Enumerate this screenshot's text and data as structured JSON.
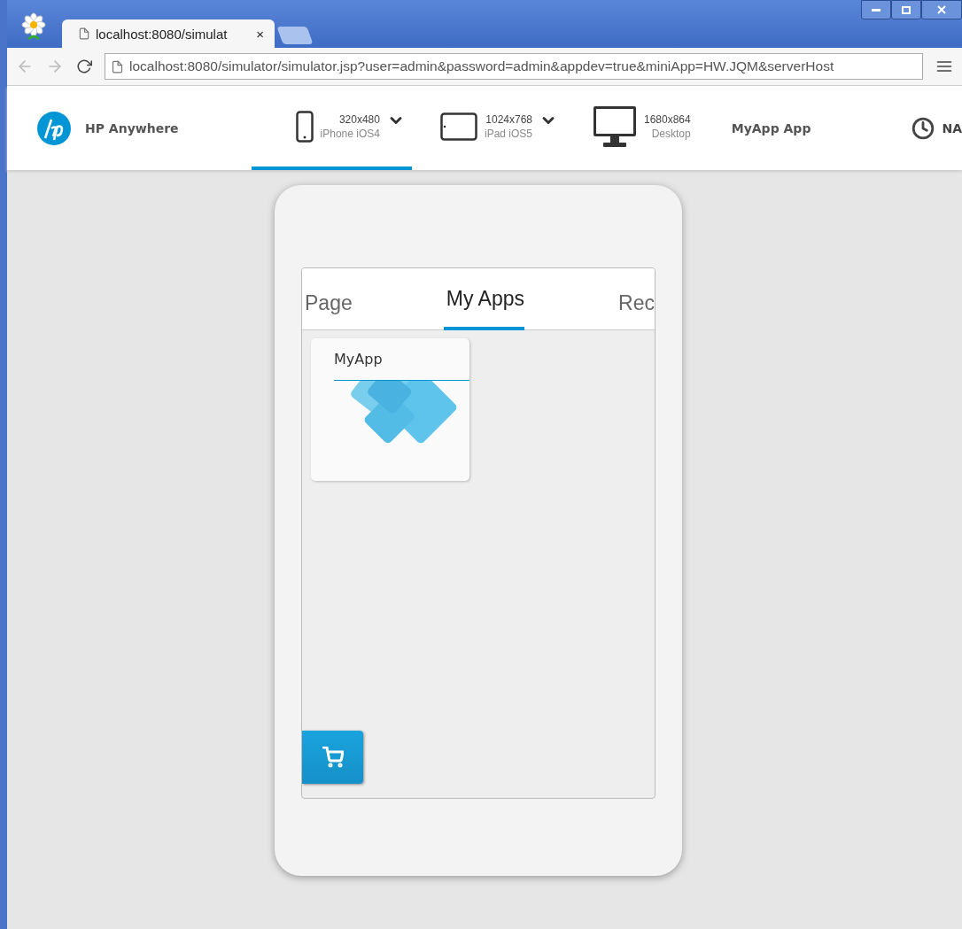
{
  "browser": {
    "tab_title": "localhost:8080/simulat",
    "tab_close": "×",
    "address": "localhost:8080/simulator/simulator.jsp?user=admin&password=admin&appdev=true&miniApp=HW.JQM&serverHost"
  },
  "header": {
    "brand": "HP Anywhere",
    "devices": [
      {
        "kind": "phone",
        "resolution": "320x480",
        "name": "iPhone iOS4",
        "dropdown": true,
        "selected": true
      },
      {
        "kind": "tablet",
        "resolution": "1024x768",
        "name": "iPad iOS5",
        "dropdown": true,
        "selected": false
      },
      {
        "kind": "desktop",
        "resolution": "1680x864",
        "name": "Desktop",
        "dropdown": false,
        "selected": false
      }
    ],
    "app_name": "MyApp App",
    "clock": "NA"
  },
  "phone": {
    "tabs": [
      {
        "label": "Page",
        "selected": false
      },
      {
        "label": "My Apps",
        "selected": true
      },
      {
        "label": "Rec",
        "selected": false
      }
    ],
    "apps": [
      {
        "name": "MyApp"
      }
    ]
  }
}
